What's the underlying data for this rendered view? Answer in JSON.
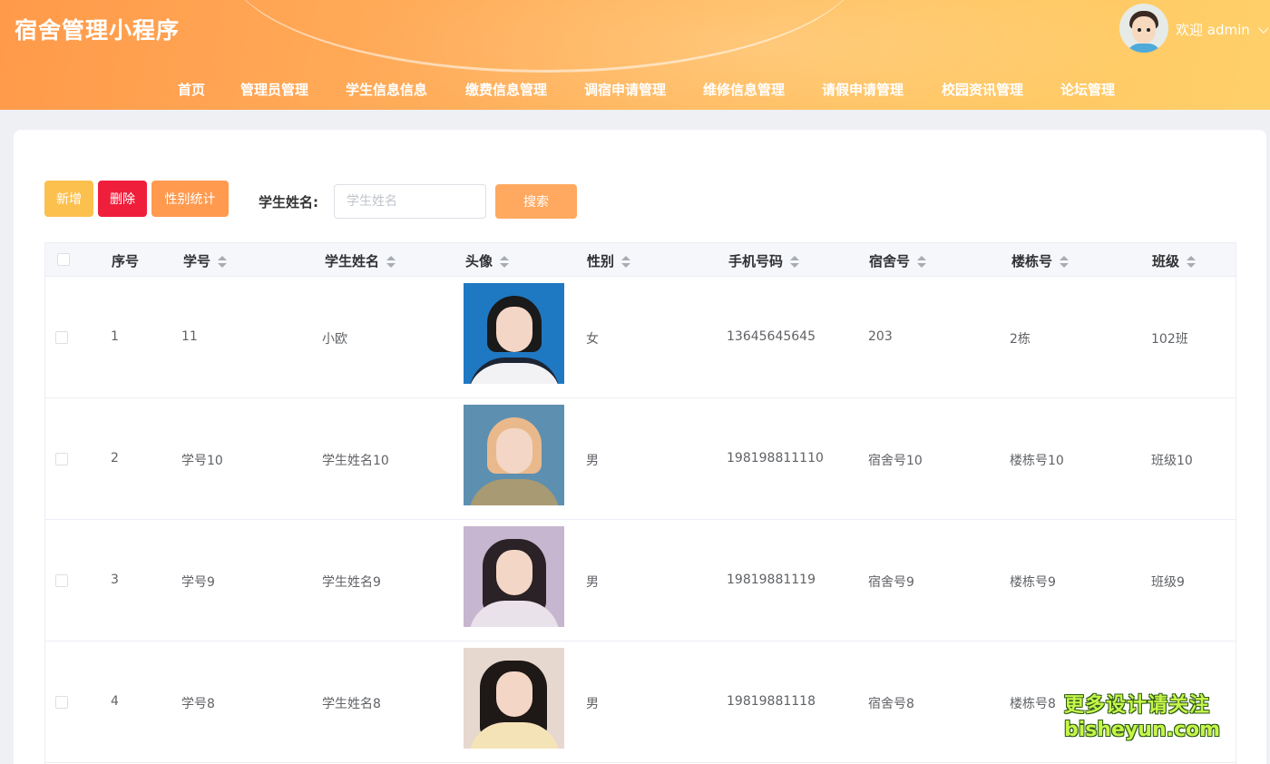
{
  "app": {
    "title": "宿舍管理小程序"
  },
  "user": {
    "welcome": "欢迎 admin"
  },
  "nav": [
    {
      "label": "首页"
    },
    {
      "label": "管理员管理"
    },
    {
      "label": "学生信息信息"
    },
    {
      "label": "缴费信息管理"
    },
    {
      "label": "调宿申请管理"
    },
    {
      "label": "维修信息管理"
    },
    {
      "label": "请假申请管理"
    },
    {
      "label": "校园资讯管理"
    },
    {
      "label": "论坛管理"
    }
  ],
  "toolbar": {
    "add_label": "新增",
    "delete_label": "删除",
    "stats_label": "性别统计",
    "search_label": "学生姓名:",
    "search_placeholder": "学生姓名",
    "search_button": "搜索"
  },
  "table": {
    "columns": [
      "序号",
      "学号",
      "学生姓名",
      "头像",
      "性别",
      "手机号码",
      "宿舍号",
      "楼栋号",
      "班级"
    ],
    "rows": [
      {
        "index": "1",
        "student_no": "11",
        "name": "小欧",
        "gender": "女",
        "phone": "13645645645",
        "dorm": "203",
        "building": "2栋",
        "class": "102班"
      },
      {
        "index": "2",
        "student_no": "学号10",
        "name": "学生姓名10",
        "gender": "男",
        "phone": "198198811110",
        "dorm": "宿舍号10",
        "building": "楼栋号10",
        "class": "班级10"
      },
      {
        "index": "3",
        "student_no": "学号9",
        "name": "学生姓名9",
        "gender": "男",
        "phone": "19819881119",
        "dorm": "宿舍号9",
        "building": "楼栋号9",
        "class": "班级9"
      },
      {
        "index": "4",
        "student_no": "学号8",
        "name": "学生姓名8",
        "gender": "男",
        "phone": "19819881118",
        "dorm": "宿舍号8",
        "building": "楼栋号8",
        "class": ""
      }
    ]
  },
  "watermark": {
    "line1": "更多设计请关注",
    "line2": "bisheyun.com"
  },
  "colors": {
    "header_start": "#ff9a4a",
    "header_end": "#ffd06a",
    "add": "#fcc04e",
    "delete": "#ef1f3c",
    "stats": "#ff9a4f",
    "search": "#ffa960"
  }
}
